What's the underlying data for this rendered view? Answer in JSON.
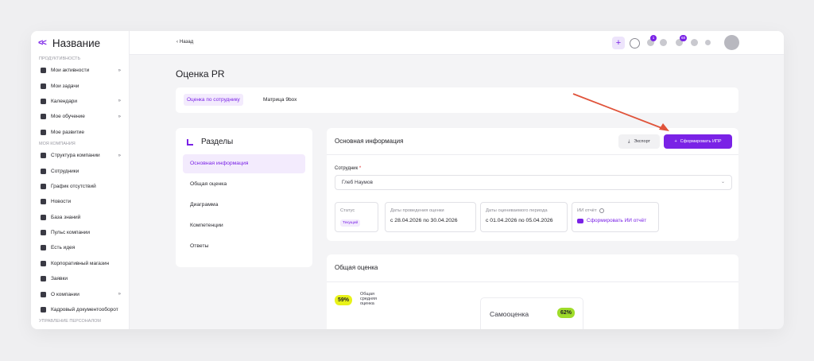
{
  "app": {
    "title": "Название",
    "collapse_icon": "double-chevron-left-icon"
  },
  "sidebar": {
    "sections": [
      {
        "title": "ПРОДУКТИВНОСТЬ",
        "items": [
          {
            "label": "Мои активности",
            "icon": "chart-icon",
            "arrow": "»"
          },
          {
            "label": "Мои задачи",
            "icon": "list-icon",
            "arrow": ""
          },
          {
            "label": "Календари",
            "icon": "calendar-icon",
            "arrow": "»"
          },
          {
            "label": "Мое обучение",
            "icon": "graduation-cap-icon",
            "arrow": "»"
          },
          {
            "label": "Мое развитие",
            "icon": "growth-icon",
            "arrow": ""
          }
        ]
      },
      {
        "title": "МОЯ КОМПАНИЯ",
        "items": [
          {
            "label": "Структура компании",
            "icon": "structure-icon",
            "arrow": "»"
          },
          {
            "label": "Сотрудники",
            "icon": "people-icon",
            "arrow": ""
          },
          {
            "label": "График отсутствий",
            "icon": "absence-calendar-icon",
            "arrow": ""
          },
          {
            "label": "Новости",
            "icon": "news-icon",
            "arrow": ""
          },
          {
            "label": "База знаний",
            "icon": "book-icon",
            "arrow": ""
          },
          {
            "label": "Пульс компании",
            "icon": "pulse-icon",
            "arrow": ""
          },
          {
            "label": "Есть идея",
            "icon": "bulb-icon",
            "arrow": ""
          },
          {
            "label": "Корпоративный магазин",
            "icon": "shop-icon",
            "arrow": ""
          },
          {
            "label": "Заявки",
            "icon": "requests-icon",
            "arrow": ""
          },
          {
            "label": "О компании",
            "icon": "company-icon",
            "arrow": "»"
          },
          {
            "label": "Кадровый документооборот",
            "icon": "documents-icon",
            "arrow": ""
          }
        ]
      },
      {
        "title": "УПРАВЛЕНИЕ ПЕРСОНАЛОМ",
        "items": []
      }
    ]
  },
  "topbar": {
    "back_label": "Назад",
    "badge_a": "1",
    "badge_b": "68",
    "icons": [
      "plus-icon",
      "search-icon",
      "chat-icon",
      "bulb-icon",
      "bell-icon",
      "help-icon",
      "dot-icon",
      "avatar"
    ]
  },
  "page": {
    "title": "Оценка PR"
  },
  "tabs": [
    {
      "label": "Оценка по сотруднику",
      "active": true
    },
    {
      "label": "Матрица 9box",
      "active": false
    }
  ],
  "sections_panel": {
    "title": "Разделы",
    "items": [
      {
        "label": "Основная информация",
        "active": true
      },
      {
        "label": "Общая оценка",
        "active": false
      },
      {
        "label": "Диаграмма",
        "active": false
      },
      {
        "label": "Компетенции",
        "active": false
      },
      {
        "label": "Ответы",
        "active": false
      }
    ]
  },
  "info": {
    "title": "Основная информация",
    "export_label": "Экспорт",
    "ipr_label": "Сформировать ИПР",
    "employee_label": "Сотрудник",
    "required_mark": "*",
    "employee_value": "Глеб Наумов",
    "status_caption": "Статус",
    "status_chip": "Текущий",
    "dates_caption": "Даты проведения оценки",
    "dates_value": "с 28.04.2026 по 30.04.2026",
    "period_caption": "Даты оцениваемого периода",
    "period_value": "с 01.04.2026 по 05.04.2026",
    "ai_caption": "ИИ отчёт",
    "ai_label": "Сформировать ИИ отчёт"
  },
  "score": {
    "title": "Общая оценка",
    "overall_pct": "59%",
    "overall_label": "Общая средняя оценка",
    "self_label": "Самооценка",
    "self_pct": "62%"
  },
  "colors": {
    "accent": "#7a22e6",
    "accent_light": "#f3ebfd",
    "arrow": "#e0533a",
    "pct_yellow": "#e8f21a",
    "pct_green": "#9fdc2a"
  }
}
